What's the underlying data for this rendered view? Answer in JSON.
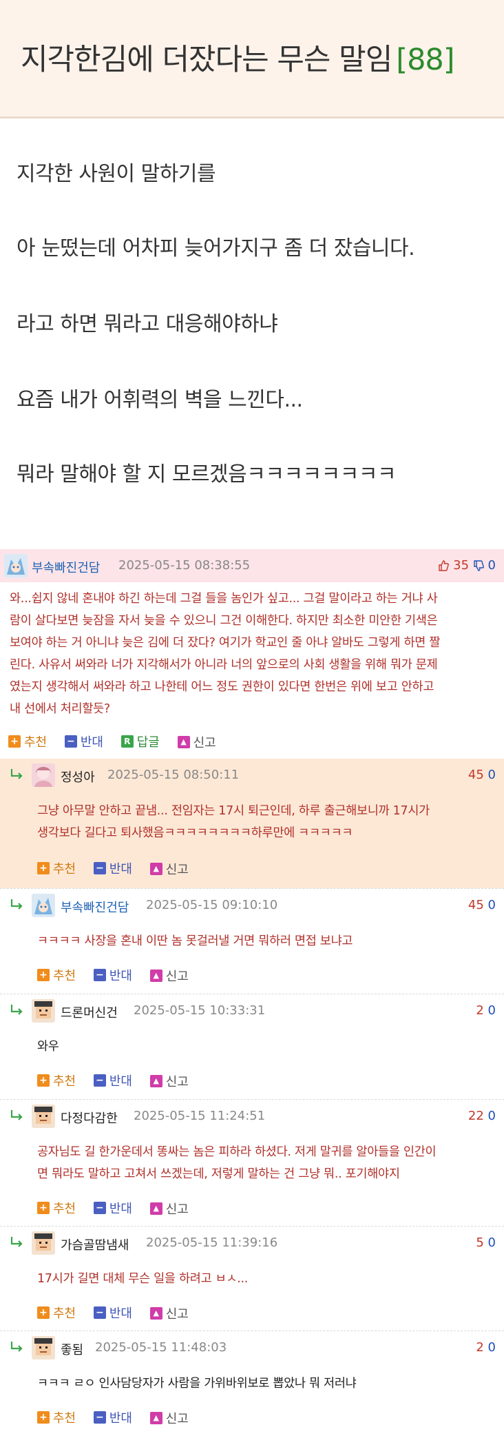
{
  "post": {
    "title": "지각한김에 더잤다는 무슨 말임",
    "comment_count": "[88]",
    "body_lines": [
      "지각한 사원이 말하기를",
      "아 눈떴는데 어차피 늦어가지구 좀 더 잤습니다.",
      "라고 하면 뭐라고 대응해야하냐",
      "요즘 내가 어휘력의 벽을 느낀다...",
      "뭐라 말해야 할 지 모르겠음ㅋㅋㅋㅋㅋㅋㅋㅋ"
    ]
  },
  "actions": {
    "recommend": "추천",
    "oppose": "반대",
    "reply": "답글",
    "report": "신고",
    "reply_badge": "R"
  },
  "comments": [
    {
      "nick": "부속빠진건담",
      "date": "2025-05-15 08:38:55",
      "up": "35",
      "down": "0",
      "text_lines": [
        "와...쉽지 않네 혼내야 하긴 하는데 그걸 들을 놈인가 싶고... 그걸 말이라고 하는 거냐 사",
        "람이 살다보면 늦잠을 자서 늦을 수 있으니 그건 이해한다. 하지만 최소한 미안한 기색은",
        "보여야 하는 거 아니냐 늦은 김에 더 잤다? 여기가 학교인 줄 아냐 알바도 그렇게 하면 짤",
        "린다. 사유서 써와라 너가 지각해서가 아니라 너의 앞으로의 사회 생활을 위해 뭐가 문제",
        "였는지 생각해서 써와라 하고 나한테 어느 정도 권한이 있다면 한번은 위에 보고 안하고",
        "내 선에서 처리할듯?"
      ]
    },
    {
      "nick": "정성아",
      "date": "2025-05-15 08:50:11",
      "up": "45",
      "down": "0",
      "text_lines": [
        "그냥 아무말 안하고 끝냄... 전임자는 17시 퇴근인데, 하루 출근해보니까 17시가",
        "생각보다 길다고 퇴사했음ㅋㅋㅋㅋㅋㅋㅋㅋ하루만에 ㅋㅋㅋㅋㅋ"
      ]
    },
    {
      "nick": "부속빠진건담",
      "date": "2025-05-15 09:10:10",
      "up": "45",
      "down": "0",
      "text_lines": [
        "ㅋㅋㅋㅋ 사장을 혼내 이딴 놈 못걸러낼 거면 뭐하러 면접 보냐고"
      ]
    },
    {
      "nick": "드론머신건",
      "date": "2025-05-15 10:33:31",
      "up": "2",
      "down": "0",
      "text_lines": [
        "와우"
      ]
    },
    {
      "nick": "다정다감한",
      "date": "2025-05-15 11:24:51",
      "up": "22",
      "down": "0",
      "text_lines": [
        "공자님도 길 한가운데서 똥싸는 놈은 피하라 하셨다. 저게 말귀를 알아들을 인간이",
        "면 뭐라도 말하고 고쳐서 쓰겠는데, 저렇게 말하는 건 그냥 뭐.. 포기해야지"
      ]
    },
    {
      "nick": "가슴골땀냄새",
      "date": "2025-05-15 11:39:16",
      "up": "5",
      "down": "0",
      "text_lines": [
        "17시가 길면 대체 무슨 일을 하려고 ㅂㅅ..."
      ]
    },
    {
      "nick": "좋됨",
      "date": "2025-05-15 11:48:03",
      "up": "2",
      "down": "0",
      "text_lines": [
        "ㅋㅋㅋ ㄹㅇ 인사담당자가 사람을 가위바위보로 뽑았나 뭐 저러냐"
      ]
    }
  ],
  "colors": {
    "title_bg": "#fdf3eb",
    "count_green": "#2c8a2c",
    "top_comment_head": "#fde4e8",
    "highlight_bg": "#fde8d6",
    "comment_text_red": "#b0302a",
    "nick_blue": "#1f63b5"
  }
}
